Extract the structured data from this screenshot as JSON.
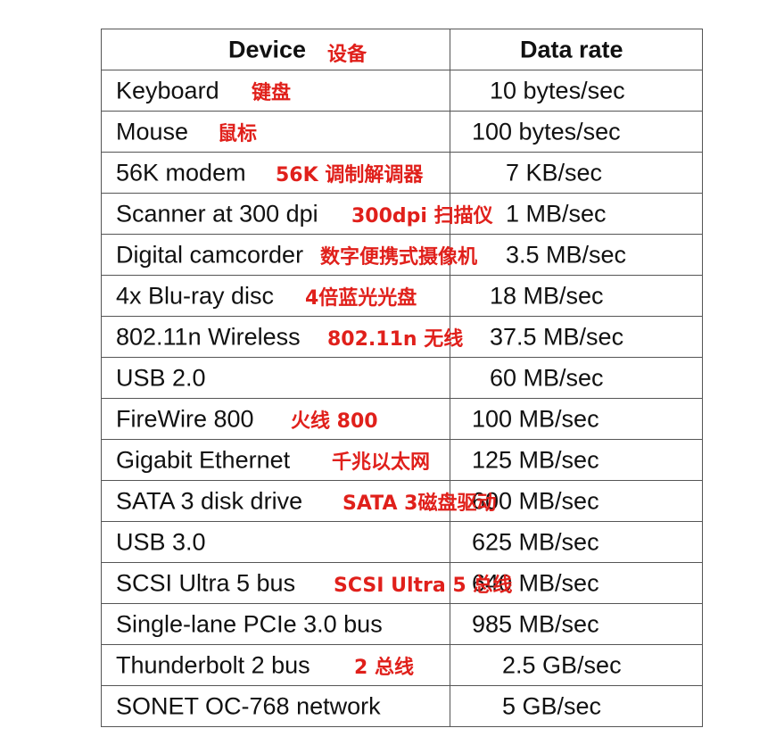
{
  "header": {
    "device": "Device",
    "device_zh": "设备",
    "rate": "Data rate"
  },
  "rows": [
    {
      "device": "Keyboard",
      "zh": "键盘",
      "rate": "10 bytes/sec"
    },
    {
      "device": "Mouse",
      "zh": "鼠标",
      "rate": "100 bytes/sec"
    },
    {
      "device": "56K modem",
      "zh": "56K 调制解调器",
      "rate": "7 KB/sec"
    },
    {
      "device": "Scanner at 300 dpi",
      "zh": "300dpi 扫描仪",
      "rate": "1 MB/sec"
    },
    {
      "device": "Digital camcorder",
      "zh": "数字便携式摄像机",
      "rate": "3.5 MB/sec"
    },
    {
      "device": "4x Blu-ray disc",
      "zh": "4倍蓝光光盘",
      "rate": "18 MB/sec"
    },
    {
      "device": "802.11n Wireless",
      "zh": "802.11n 无线",
      "rate": "37.5 MB/sec"
    },
    {
      "device": "USB 2.0",
      "zh": "",
      "rate": "60 MB/sec"
    },
    {
      "device": "FireWire 800",
      "zh": "火线 800",
      "rate": "100 MB/sec"
    },
    {
      "device": "Gigabit Ethernet",
      "zh": "千兆以太网",
      "rate": "125 MB/sec"
    },
    {
      "device": "SATA 3 disk drive",
      "zh": "SATA 3磁盘驱动",
      "rate": "600 MB/sec"
    },
    {
      "device": "USB 3.0",
      "zh": "",
      "rate": "625 MB/sec"
    },
    {
      "device": "SCSI Ultra 5 bus",
      "zh": "SCSI Ultra 5 总线",
      "rate": "640 MB/sec"
    },
    {
      "device": "Single-lane PCIe 3.0 bus",
      "zh": "",
      "rate": "985 MB/sec"
    },
    {
      "device": "Thunderbolt 2 bus",
      "zh": "2 总线",
      "rate": "2.5 GB/sec"
    },
    {
      "device": "SONET OC-768 network",
      "zh": "",
      "rate": "5 GB/sec"
    }
  ]
}
